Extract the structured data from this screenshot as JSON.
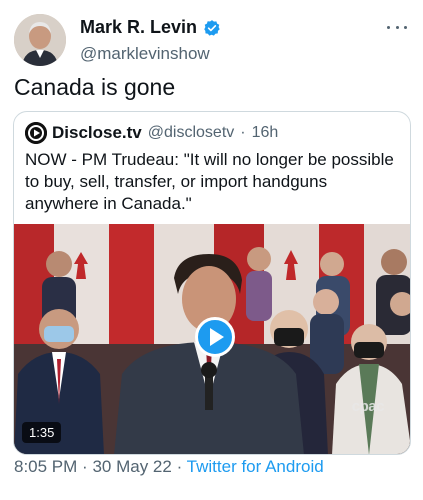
{
  "author": {
    "name": "Mark R. Levin",
    "handle": "@marklevinshow",
    "verified_icon": "verified-badge-icon",
    "verified_color": "#1d9bf0"
  },
  "tweet": {
    "text": "Canada is gone"
  },
  "quote": {
    "name": "Disclose.tv",
    "handle": "@disclosetv",
    "separator": "·",
    "time": "16h",
    "text": "NOW - PM Trudeau: \"It will no longer be possible to buy, sell, transfer, or import handguns anywhere in Canada.\"",
    "video": {
      "duration": "1:35",
      "watermark": "cpac",
      "play_icon": "play-icon"
    }
  },
  "footer": {
    "time": "8:05 PM",
    "separator": "·",
    "date": "30 May 22",
    "source": "Twitter for Android"
  },
  "colors": {
    "accent": "#1d9bf0",
    "text_primary": "#0f1419",
    "text_secondary": "#536471",
    "border": "#cfd9de"
  }
}
